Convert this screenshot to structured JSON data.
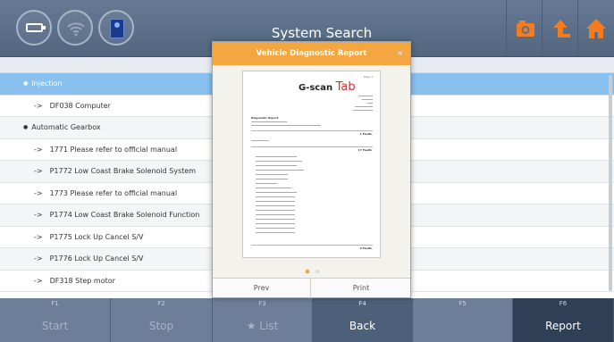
{
  "header": {
    "title": "System Search",
    "icons": [
      "battery-icon",
      "wifi-icon",
      "vci-icon",
      "camera-icon",
      "upload-icon",
      "home-icon"
    ]
  },
  "list": {
    "groups": [
      {
        "label": "Injection",
        "selected": true,
        "items": [
          "DF038 Computer"
        ]
      },
      {
        "label": "Automatic Gearbox",
        "selected": false,
        "items": [
          "1771 Please refer to official manual",
          "P1772 Low Coast Brake Solenoid System",
          "1773 Please refer to official manual",
          "P1774 Low Coast Brake Solenoid Function",
          "P1775 Lock Up Cancel S/V",
          "P1776 Lock Up Cancel S/V",
          "DF318 Step motor"
        ]
      }
    ],
    "item_prefix": "->"
  },
  "fkeys": [
    {
      "fn": "F1",
      "label": "Start"
    },
    {
      "fn": "F2",
      "label": "Stop"
    },
    {
      "fn": "F3",
      "label": "★ List"
    },
    {
      "fn": "F4",
      "label": "Back"
    },
    {
      "fn": "F5",
      "label": ""
    },
    {
      "fn": "F6",
      "label": "Report"
    }
  ],
  "dialog": {
    "title": "Vehicle Diagnostic Report",
    "close": "×",
    "prev": "Prev",
    "print": "Print",
    "page_count": 2,
    "current_page": 1,
    "preview": {
      "page": "Page 1",
      "logo_a": "G-scan",
      "logo_b": "Tab",
      "section": "Diagnostic Report",
      "faults_a": "1 Faults",
      "faults_b": "17 Faults",
      "faults_c": "0 Faults"
    }
  },
  "colors": {
    "accent_orange": "#f4a640",
    "selected_row": "#88c0f0",
    "topbar": "#5b6f8a"
  }
}
